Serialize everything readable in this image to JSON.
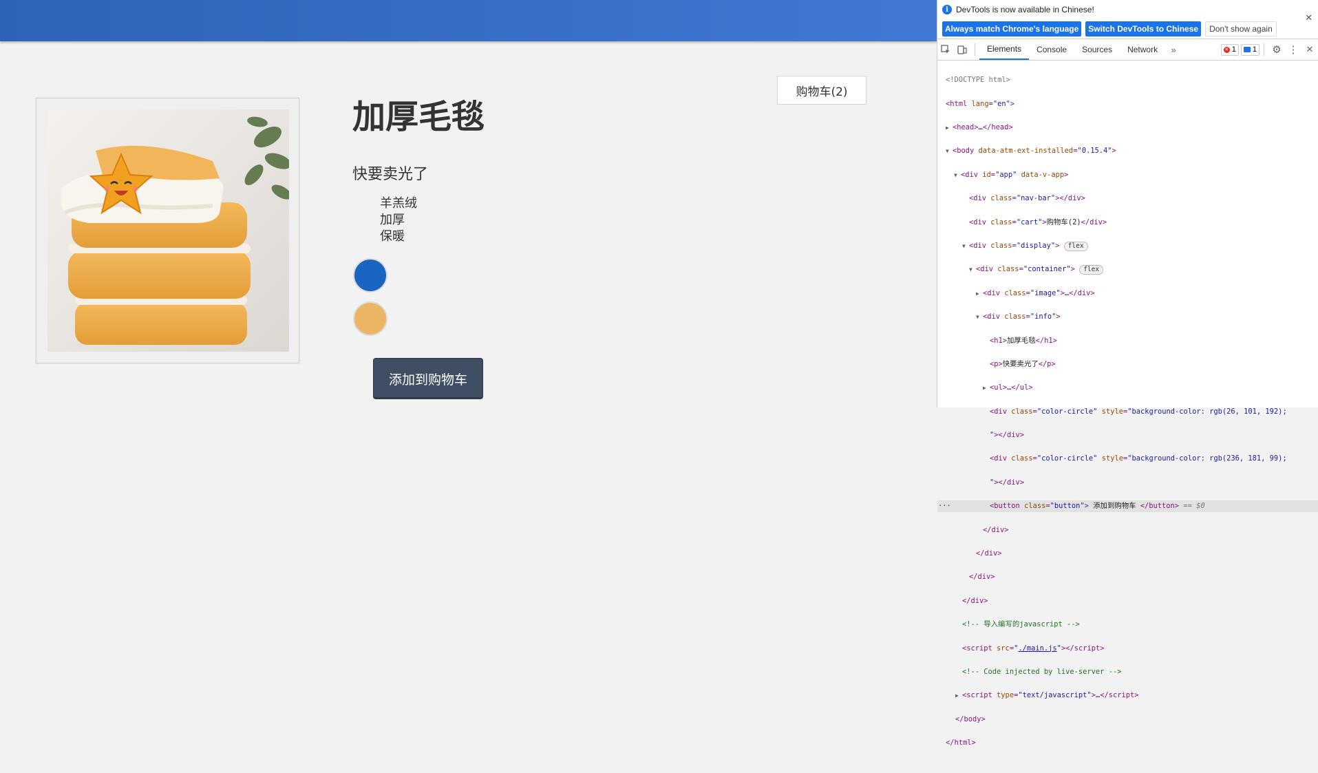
{
  "page": {
    "cart_label": "购物车(2)",
    "title": "加厚毛毯",
    "subtitle": "快要卖光了",
    "features": [
      "羊羔绒",
      "加厚",
      "保暖"
    ],
    "colors": [
      "#1a65c0",
      "#ecb563"
    ],
    "add_button": "添加到购物车"
  },
  "devtools": {
    "banner_text": "DevTools is now available in Chinese!",
    "btn_match": "Always match Chrome's language",
    "btn_switch": "Switch DevTools to Chinese",
    "btn_dismiss": "Don't show again",
    "tabs": [
      "Elements",
      "Console",
      "Sources",
      "Network"
    ],
    "error_count": "1",
    "message_count": "1",
    "dom": {
      "doctype": "<!DOCTYPE html>",
      "body_attr_value": "\"0.15.4\"",
      "cart_text": "购物车(2)",
      "h1_text": "加厚毛毯",
      "p_text": "快要卖光了",
      "color1_style": "\"background-color: rgb(26, 101, 192);",
      "color2_style": "\"background-color: rgb(236, 181, 99);",
      "button_text": " 添加到购物车 ",
      "comment1": "<!-- 导入编写的javascript -->",
      "script_src": "./main.js",
      "comment2": "<!-- Code injected by live-server -->",
      "selected_marker": "== $0"
    }
  }
}
